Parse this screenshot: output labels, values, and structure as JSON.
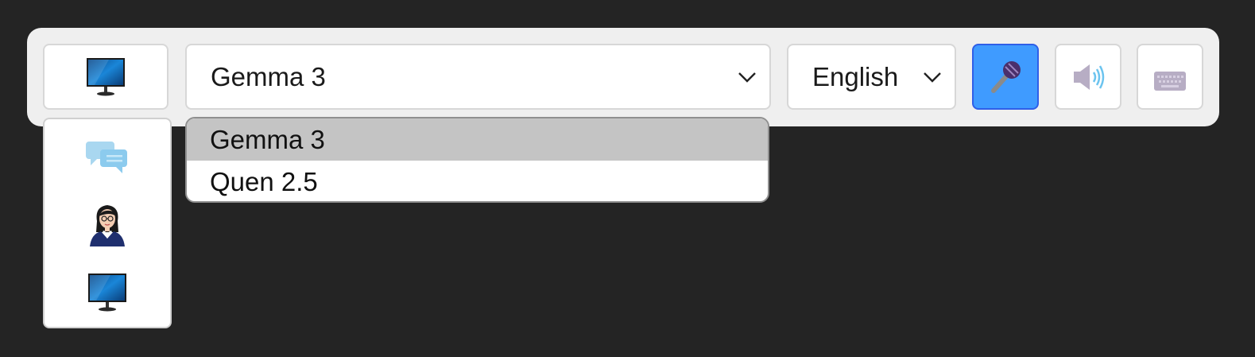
{
  "toolbar": {
    "view_button": {
      "icon": "monitor-icon"
    },
    "model_select": {
      "value": "Gemma 3"
    },
    "language_select": {
      "value": "English"
    },
    "mic_button": {
      "icon": "microphone-icon",
      "active": true,
      "color": "#3f9bff"
    },
    "speaker_button": {
      "icon": "speaker-icon"
    },
    "keyboard_button": {
      "icon": "keyboard-icon"
    }
  },
  "view_menu": {
    "items": [
      {
        "icon": "chat-bubbles-icon"
      },
      {
        "icon": "avatar-woman-icon"
      },
      {
        "icon": "monitor-icon"
      }
    ]
  },
  "model_menu": {
    "options": [
      {
        "label": "Gemma 3",
        "selected": true
      },
      {
        "label": "Quen 2.5",
        "selected": false
      }
    ]
  },
  "colors": {
    "background": "#242424",
    "toolbar": "#efefef",
    "accent": "#3f9bff",
    "selected_option": "#c4c4c4"
  }
}
